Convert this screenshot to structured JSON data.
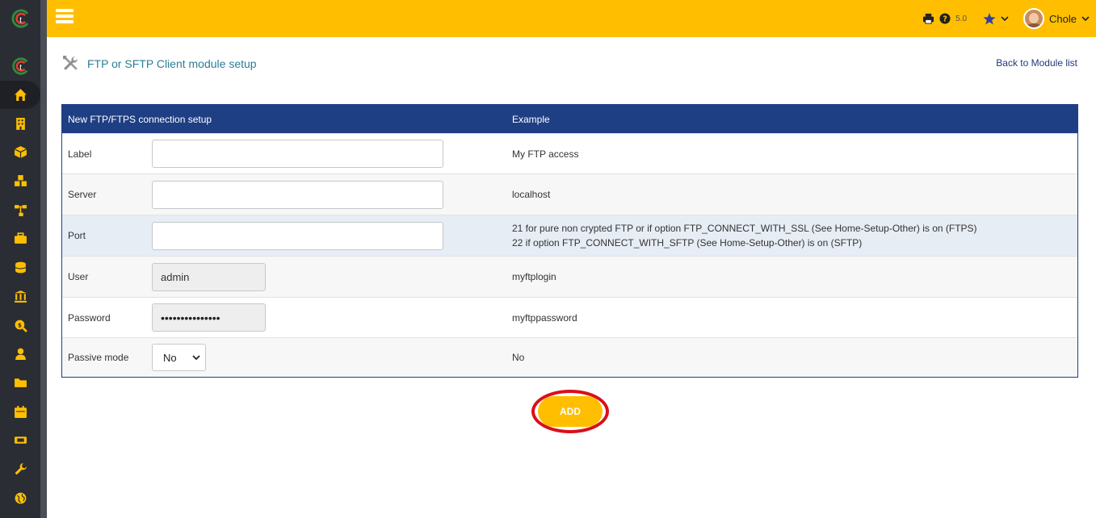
{
  "app": {
    "version": "5.0",
    "user": "Chole"
  },
  "page": {
    "title": "FTP or SFTP Client module setup",
    "back_link": "Back to Module list"
  },
  "table": {
    "headers": [
      "New FTP/FTPS connection setup",
      "Example"
    ],
    "rows": [
      {
        "label": "Label",
        "value": "",
        "example": "My FTP access"
      },
      {
        "label": "Server",
        "value": "",
        "example": "localhost"
      },
      {
        "label": "Port",
        "value": "",
        "example_line1": "21 for pure non crypted FTP or if option FTP_CONNECT_WITH_SSL (See Home-Setup-Other) is on (FTPS)",
        "example_line2": "22 if option FTP_CONNECT_WITH_SFTP (See Home-Setup-Other) is on (SFTP)"
      },
      {
        "label": "User",
        "value": "admin",
        "example": "myftplogin"
      },
      {
        "label": "Password",
        "value": "•••••••••••••••",
        "example": "myftppassword"
      },
      {
        "label": "Passive mode",
        "value": "No",
        "example": "No"
      }
    ]
  },
  "add_button": "ADD",
  "sidebar": {
    "items": [
      "home-icon",
      "building-icon",
      "box-icon",
      "boxes-icon",
      "sitemap-icon",
      "briefcase-icon",
      "coins-icon",
      "bank-icon",
      "search-dollar-icon",
      "user-tie-icon",
      "folder-icon",
      "calendar-icon",
      "ticket-icon",
      "wrench-icon",
      "globe-icon"
    ]
  },
  "colors": {
    "topbar": "#ffbf00",
    "sidebar": "#2b2d34",
    "header": "#1e3f84",
    "icon": "#ffbf00",
    "highlight": "#d8101a"
  }
}
